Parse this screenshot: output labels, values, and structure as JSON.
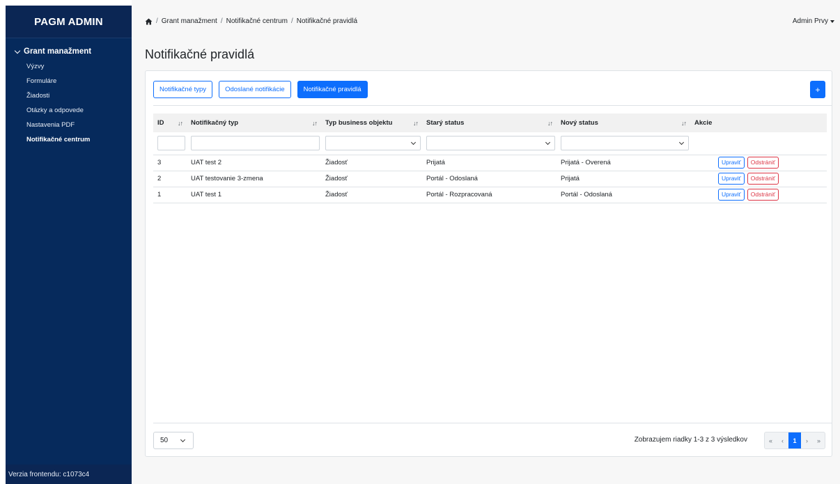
{
  "sidebar": {
    "brand": "PAGM ADMIN",
    "section_label": "Grant manažment",
    "items": [
      {
        "label": "Výzvy"
      },
      {
        "label": "Formuláre"
      },
      {
        "label": "Žiadosti"
      },
      {
        "label": "Otázky a odpovede"
      },
      {
        "label": "Nastavenia PDF"
      },
      {
        "label": "Notifikačné centrum",
        "active": true
      }
    ],
    "footer": "Verzia frontendu: c1073c4"
  },
  "breadcrumb": {
    "items": [
      "Grant manažment",
      "Notifikačné centrum",
      "Notifikačné pravidlá"
    ],
    "separator": "/"
  },
  "user_menu": {
    "label": "Admin Prvy"
  },
  "page_title": "Notifikačné pravidlá",
  "tabs": [
    {
      "label": "Notifikačné typy",
      "active": false
    },
    {
      "label": "Odoslané notifikácie",
      "active": false
    },
    {
      "label": "Notifikačné pravidlá",
      "active": true
    }
  ],
  "add_button": {
    "label": "+"
  },
  "table": {
    "headers": {
      "id": "ID",
      "type": "Notifikačný typ",
      "business": "Typ business objektu",
      "old_status": "Starý status",
      "new_status": "Nový status",
      "actions": "Akcie"
    },
    "sort_glyph": "↓↑",
    "rows": [
      {
        "id": "3",
        "type": "UAT test 2",
        "business": "Žiadosť",
        "old_status": "Prijatá",
        "new_status": "Prijatá - Overená"
      },
      {
        "id": "2",
        "type": "UAT testovanie 3-zmena",
        "business": "Žiadosť",
        "old_status": "Portál - Odoslaná",
        "new_status": "Prijatá"
      },
      {
        "id": "1",
        "type": "UAT test 1",
        "business": "Žiadosť",
        "old_status": "Portál - Rozpracovaná",
        "new_status": "Portál - Odoslaná"
      }
    ],
    "edit_label": "Upraviť",
    "delete_label": "Odstrániť"
  },
  "footer": {
    "page_size": "50",
    "summary": "Zobrazujem riadky 1-3 z 3 výsledkov",
    "pager": {
      "first": "«",
      "prev": "‹",
      "current": "1",
      "next": "›",
      "last": "»"
    }
  },
  "colors": {
    "sidebar_bg": "#062a5c",
    "primary": "#0d6efd",
    "danger": "#dc3545"
  }
}
